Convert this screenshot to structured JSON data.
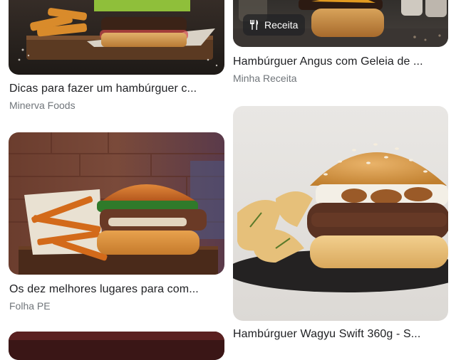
{
  "results": [
    {
      "title": "Dicas para fazer um hambúrguer c...",
      "source": "Minerva Foods"
    },
    {
      "title": "Hambúrguer Angus com Geleia de ...",
      "source": "Minha Receita",
      "badge": "Receita"
    },
    {
      "title": "Os dez melhores lugares para com...",
      "source": "Folha PE"
    },
    {
      "title": "Hambúrguer Wagyu Swift 360g - S..."
    }
  ],
  "icons": {
    "badge": "cutlery-icon"
  }
}
